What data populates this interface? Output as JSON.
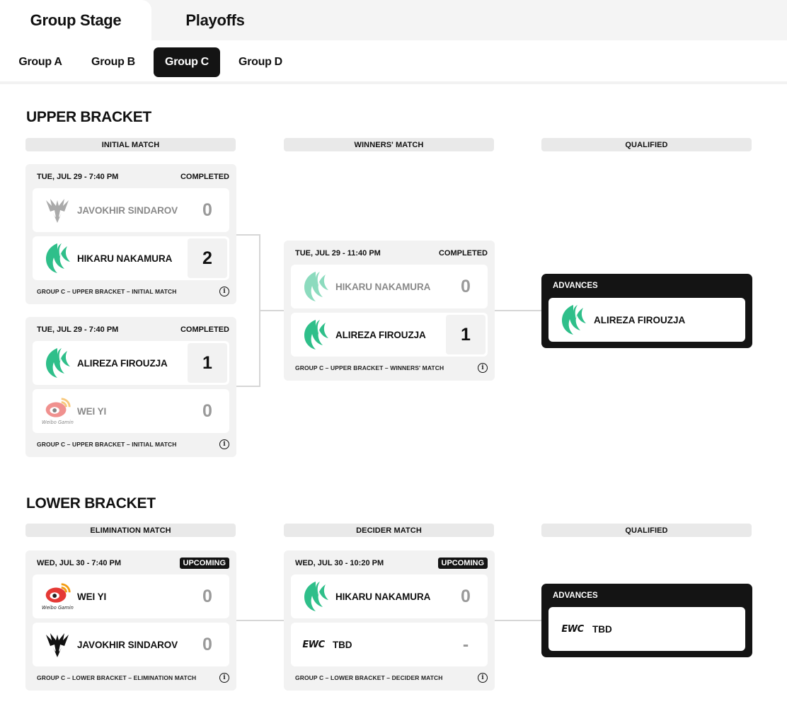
{
  "stage_tabs": [
    {
      "label": "Group Stage"
    },
    {
      "label": "Playoffs"
    }
  ],
  "group_tabs": [
    {
      "label": "Group A"
    },
    {
      "label": "Group B"
    },
    {
      "label": "Group C"
    },
    {
      "label": "Group D"
    }
  ],
  "active_group": "Group C",
  "upper": {
    "title": "UPPER BRACKET",
    "col_headers": [
      "INITIAL MATCH",
      "WINNERS' MATCH",
      "QUALIFIED"
    ],
    "matches": [
      {
        "date": "TUE, JUL 29 - 7:40 PM",
        "status": "COMPLETED",
        "p1": {
          "name": "JAVOKHIR SINDAROV",
          "score": "0"
        },
        "p2": {
          "name": "HIKARU NAKAMURA",
          "score": "2"
        },
        "footer": "GROUP C – UPPER BRACKET – INITIAL MATCH"
      },
      {
        "date": "TUE, JUL 29 - 7:40 PM",
        "status": "COMPLETED",
        "p1": {
          "name": "ALIREZA FIROUZJA",
          "score": "1"
        },
        "p2": {
          "name": "WEI YI",
          "score": "0"
        },
        "footer": "GROUP C – UPPER BRACKET – INITIAL MATCH"
      },
      {
        "date": "TUE, JUL 29 - 11:40 PM",
        "status": "COMPLETED",
        "p1": {
          "name": "HIKARU NAKAMURA",
          "score": "0"
        },
        "p2": {
          "name": "ALIREZA FIROUZJA",
          "score": "1"
        },
        "footer": "GROUP C – UPPER BRACKET – WINNERS' MATCH"
      }
    ],
    "advances": {
      "label": "ADVANCES",
      "name": "ALIREZA FIROUZJA"
    }
  },
  "lower": {
    "title": "LOWER BRACKET",
    "col_headers": [
      "ELIMINATION MATCH",
      "DECIDER MATCH",
      "QUALIFIED"
    ],
    "matches": [
      {
        "date": "WED, JUL 30 - 7:40 PM",
        "status": "UPCOMING",
        "p1": {
          "name": "WEI YI",
          "score": "0"
        },
        "p2": {
          "name": "JAVOKHIR SINDAROV",
          "score": "0"
        },
        "footer": "GROUP C – LOWER BRACKET – ELIMINATION MATCH"
      },
      {
        "date": "WED, JUL 30 - 10:20 PM",
        "status": "UPCOMING",
        "p1": {
          "name": "HIKARU NAKAMURA",
          "score": "0"
        },
        "p2": {
          "name": "TBD",
          "score": "-"
        },
        "footer": "GROUP C – LOWER BRACKET – DECIDER MATCH"
      }
    ],
    "advances": {
      "label": "ADVANCES",
      "name": "TBD"
    }
  },
  "logo_text": {
    "weibo": "Weibo Gaming",
    "ewc": "EWC"
  },
  "colors": {
    "falcons_green": "#2fbf8a",
    "falcons_light": "#8fdcbf",
    "weibo_red": "#e53935",
    "weibo_orange": "#f39c12",
    "dark": "#141414"
  }
}
